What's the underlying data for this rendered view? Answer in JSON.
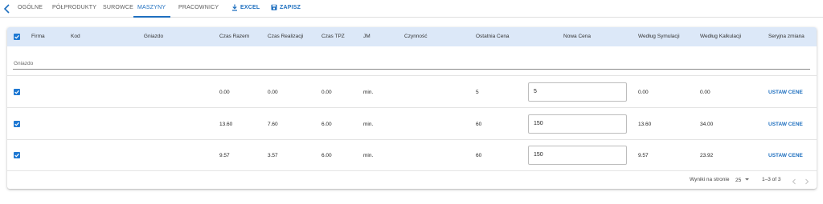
{
  "tabs": [
    {
      "label": "OGÓLNE"
    },
    {
      "label": "PÓŁPRODUKTY"
    },
    {
      "label": "SUROWCE"
    },
    {
      "label": "MASZYNY"
    },
    {
      "label": "PRACOWNICY"
    }
  ],
  "toolbar": {
    "excel_label": "EXCEL",
    "save_label": "ZAPISZ"
  },
  "colors": {
    "accent": "#1e6fbf",
    "header_bg": "#dce8f8",
    "checkbox": "#1e78d2"
  },
  "table": {
    "headers": {
      "firma": "Firma",
      "kod": "Kod",
      "gniazdo": "Gniazdo",
      "czas_razem": "Czas Razem",
      "czas_realizacji": "Czas Realizacji",
      "czas_tpz": "Czas TPZ",
      "jm": "JM",
      "czynnosc": "Czynność",
      "ostatnia_cena": "Ostatnia Cena",
      "nowa_cena": "Nowa Cena",
      "wedlug_symulacji": "Według Symulacji",
      "wedlug_kalkulacji": "Według Kalkulacji",
      "seryjna_zmiana": "Seryjna zmiana"
    },
    "filter_label": "Gniazdo",
    "rows": [
      {
        "checked": true,
        "czas_razem": "0.00",
        "czas_realizacji": "0.00",
        "czas_tpz": "0.00",
        "jm": "min.",
        "ostatnia_cena": "5",
        "nowa_cena": "5",
        "wedlug_symulacji": "0.00",
        "wedlug_kalkulacji": "0.00",
        "action": "USTAW CENE"
      },
      {
        "checked": true,
        "czas_razem": "13.60",
        "czas_realizacji": "7.60",
        "czas_tpz": "6.00",
        "jm": "min.",
        "ostatnia_cena": "60",
        "nowa_cena": "150",
        "wedlug_symulacji": "13.60",
        "wedlug_kalkulacji": "34.00",
        "action": "USTAW CENE"
      },
      {
        "checked": true,
        "czas_razem": "9.57",
        "czas_realizacji": "3.57",
        "czas_tpz": "6.00",
        "jm": "min.",
        "ostatnia_cena": "60",
        "nowa_cena": "150",
        "wedlug_symulacji": "9.57",
        "wedlug_kalkulacji": "23.92",
        "action": "USTAW CENE"
      }
    ]
  },
  "pagination": {
    "per_page_label": "Wyniki na stronie",
    "per_page_value": "25",
    "range": "1–3 of 3"
  }
}
